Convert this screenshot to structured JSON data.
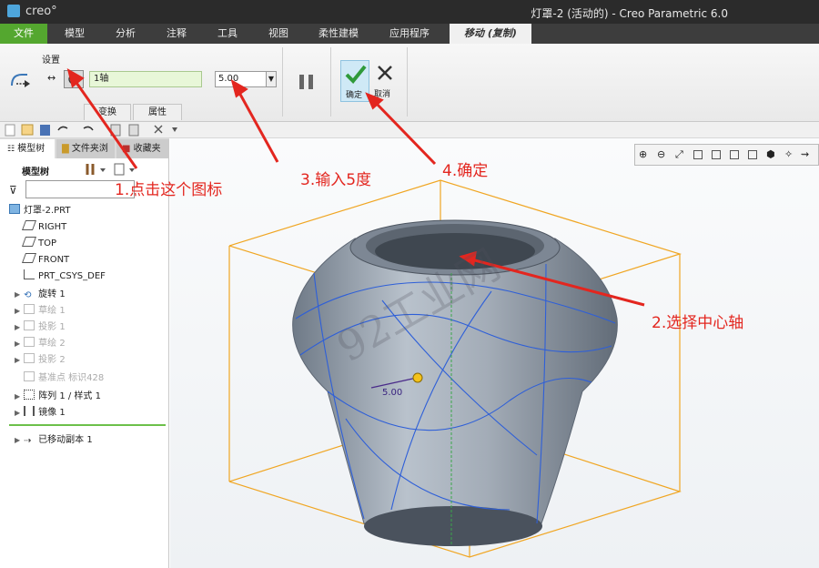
{
  "window": {
    "brand": "creo°",
    "title": "灯罩-2 (活动的) - Creo Parametric 6.0"
  },
  "menu": {
    "file": "文件",
    "model": "模型",
    "analysis": "分析",
    "annotate": "注释",
    "tools": "工具",
    "view": "视图",
    "flexible": "柔性建模",
    "apps": "应用程序",
    "move_copy": "移动 (复制)"
  },
  "ribbon": {
    "settings_label": "设置",
    "axis_value": "1轴",
    "angle_value": "5.00",
    "tab_transform": "变换",
    "tab_properties": "属性",
    "ok_label": "确定",
    "cancel_label": "取消"
  },
  "panel": {
    "tab_model_tree": "模型树",
    "tab_folder": "文件夹浏",
    "tab_favorites": "收藏夹",
    "tree_title": "模型树",
    "items": [
      {
        "label": "灯罩-2.PRT",
        "dim": false
      },
      {
        "label": "RIGHT",
        "dim": false
      },
      {
        "label": "TOP",
        "dim": false
      },
      {
        "label": "FRONT",
        "dim": false
      },
      {
        "label": "PRT_CSYS_DEF",
        "dim": false
      },
      {
        "label": "旋转 1",
        "dim": false
      },
      {
        "label": "草绘 1",
        "dim": true
      },
      {
        "label": "投影 1",
        "dim": true
      },
      {
        "label": "草绘 2",
        "dim": true
      },
      {
        "label": "投影 2",
        "dim": true
      },
      {
        "label": "基准点 标识428",
        "dim": true
      },
      {
        "label": "阵列 1 / 样式 1",
        "dim": false
      },
      {
        "label": "镜像 1",
        "dim": false
      },
      {
        "label": "已移动副本 1",
        "dim": false
      }
    ]
  },
  "viewport": {
    "dim_label": "5.00",
    "watermark": "92工业网"
  },
  "annotations": {
    "step1": "1.点击这个图标",
    "step2": "2.选择中心轴",
    "step3": "3.输入5度",
    "step4": "4.确定"
  },
  "colors": {
    "file_tab": "#54a72f",
    "annotation": "#e3261f",
    "bounding_box": "#f0a623",
    "curves": "#2e5fd8",
    "part": "#8c97a4"
  }
}
